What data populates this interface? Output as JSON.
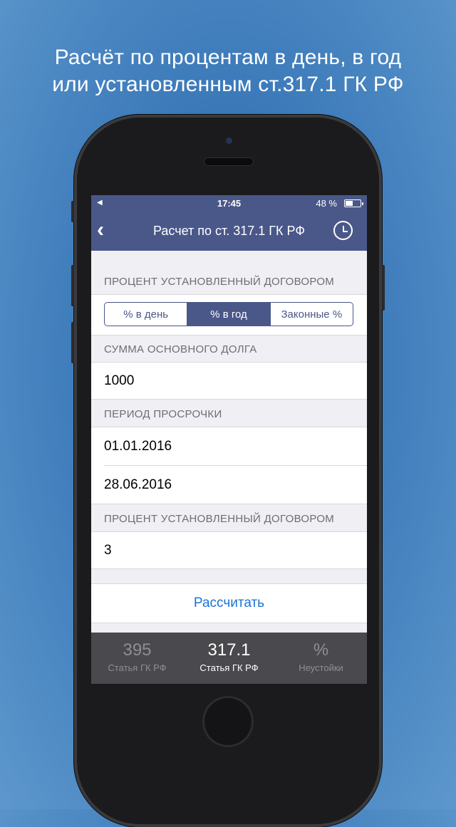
{
  "headline": {
    "line1": "Расчёт по процентам в день, в год",
    "line2": "или установленным ст.317.1 ГК РФ"
  },
  "statusbar": {
    "time": "17:45",
    "battery": "48 %",
    "battery_level": 0.48
  },
  "navbar": {
    "title": "Расчет по ст. 317.1 ГК РФ",
    "back_icon": "chevron-left-icon",
    "history_icon": "clock-icon"
  },
  "section_rate_type": {
    "header": "ПРОЦЕНТ УСТАНОВЛЕННЫЙ ДОГОВОРОМ",
    "segments": [
      "% в день",
      "% в год",
      "Законные %"
    ],
    "selected": "% в год"
  },
  "section_debt": {
    "header": "СУММА ОСНОВНОГО ДОЛГА",
    "value": "1000"
  },
  "section_period": {
    "header": "ПЕРИОД ПРОСРОЧКИ",
    "start_date": "01.01.2016",
    "end_date": "28.06.2016"
  },
  "section_rate_value": {
    "header": "ПРОЦЕНТ УСТАНОВЛЕННЫЙ ДОГОВОРОМ",
    "value": "3"
  },
  "calculate_button": "Рассчитать",
  "tabbar": [
    {
      "big": "395",
      "small": "Статья ГК РФ",
      "active": false
    },
    {
      "big": "317.1",
      "small": "Статья ГК РФ",
      "active": true
    },
    {
      "big": "%",
      "small": "Неустойки",
      "active": false
    }
  ],
  "colors": {
    "nav": "#4a5789",
    "accent_link": "#1a73d9",
    "background": "#3a78b8"
  }
}
